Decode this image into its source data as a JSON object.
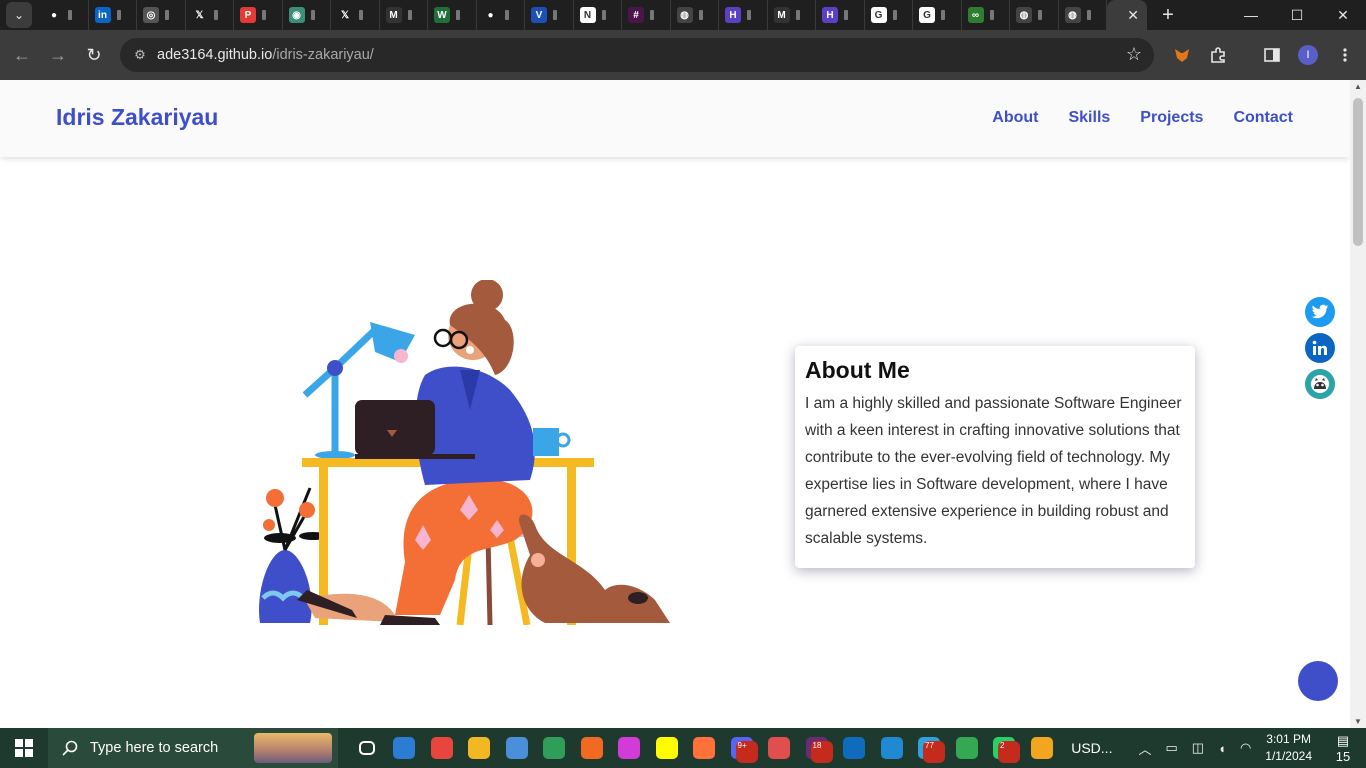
{
  "browser": {
    "menu_glyph": "⌄",
    "tabs": [
      {
        "icon": "github-icon",
        "color": "#1f1f1f",
        "glyph": "●"
      },
      {
        "icon": "linkedin-icon",
        "color": "#0a66c2",
        "glyph": "in"
      },
      {
        "icon": "globe-icon",
        "color": "#555555",
        "glyph": "◎"
      },
      {
        "icon": "x-icon",
        "color": "#1f1f1f",
        "glyph": "𝕏"
      },
      {
        "icon": "p-icon",
        "color": "#e53935",
        "glyph": "P"
      },
      {
        "icon": "openai-icon",
        "color": "#3b8f78",
        "glyph": "◉"
      },
      {
        "icon": "x-icon",
        "color": "#1f1f1f",
        "glyph": "𝕏"
      },
      {
        "icon": "m-icon",
        "color": "#333333",
        "glyph": "M"
      },
      {
        "icon": "w-icon",
        "color": "#1f6f3a",
        "glyph": "W"
      },
      {
        "icon": "github-icon",
        "color": "#1f1f1f",
        "glyph": "●"
      },
      {
        "icon": "v-icon",
        "color": "#1d4fb8",
        "glyph": "V"
      },
      {
        "icon": "notion-icon",
        "color": "#ffffff",
        "glyph": "N"
      },
      {
        "icon": "slack-icon",
        "color": "#4a154b",
        "glyph": "#"
      },
      {
        "icon": "chrome-icon",
        "color": "#444444",
        "glyph": "◍"
      },
      {
        "icon": "h-icon",
        "color": "#5b3fc4",
        "glyph": "H"
      },
      {
        "icon": "gmail-icon",
        "color": "#333333",
        "glyph": "M"
      },
      {
        "icon": "h-icon",
        "color": "#5b3fc4",
        "glyph": "H"
      },
      {
        "icon": "google-icon",
        "color": "#ffffff",
        "glyph": "G"
      },
      {
        "icon": "google-icon",
        "color": "#ffffff",
        "glyph": "G"
      },
      {
        "icon": "link-icon",
        "color": "#2e7d32",
        "glyph": "∞"
      },
      {
        "icon": "chrome-icon",
        "color": "#444444",
        "glyph": "◍"
      },
      {
        "icon": "chrome-icon",
        "color": "#444444",
        "glyph": "◍"
      }
    ],
    "active_tab_close": "✕",
    "new_tab": "+",
    "window_controls": {
      "minimize": "—",
      "maximize": "☐",
      "close": "✕"
    },
    "back": "←",
    "forward": "→",
    "reload": "↻",
    "site_info": "⚙",
    "url_host": "ade3164.github.io",
    "url_path": "/idris-zakariyau/",
    "bookmark": "☆",
    "profile_initial": "I"
  },
  "site": {
    "brand": "Idris Zakariyau",
    "nav": {
      "about": "About",
      "skills": "Skills",
      "projects": "Projects",
      "contact": "Contact"
    },
    "about": {
      "title": "About Me",
      "body": "I am a highly skilled and passionate Software Engineer with a keen interest in crafting innovative solutions that contribute to the ever-evolving field of technology. My expertise lies in Software development, where I have garnered extensive experience in building robust and scalable systems."
    },
    "socials": [
      {
        "name": "twitter-icon",
        "color": "#1d9bf0"
      },
      {
        "name": "linkedin-icon",
        "color": "#0a66c2"
      },
      {
        "name": "github-icon",
        "color": "#2ba3a8"
      }
    ],
    "fab_color": "#3f4fc9"
  },
  "taskbar": {
    "search_placeholder": "Type here to search",
    "apps": [
      {
        "name": "task-view-icon",
        "color": "#1e3a2e",
        "badge": ""
      },
      {
        "name": "mail-icon",
        "color": "#2b7cd3",
        "badge": ""
      },
      {
        "name": "chrome-icon",
        "color": "#e8453c",
        "badge": ""
      },
      {
        "name": "file-explorer-icon",
        "color": "#f2b824",
        "badge": ""
      },
      {
        "name": "store-icon",
        "color": "#4a90d9",
        "badge": ""
      },
      {
        "name": "stocks-icon",
        "color": "#2e9e58",
        "badge": ""
      },
      {
        "name": "brave-icon",
        "color": "#f26a21",
        "badge": ""
      },
      {
        "name": "app-w-icon",
        "color": "#d23bd8",
        "badge": ""
      },
      {
        "name": "snapchat-icon",
        "color": "#fffc00",
        "badge": ""
      },
      {
        "name": "firefox-icon",
        "color": "#ff7139",
        "badge": ""
      },
      {
        "name": "discord-icon",
        "color": "#5865f2",
        "badge": "9+"
      },
      {
        "name": "link-app-icon",
        "color": "#e04e4e",
        "badge": ""
      },
      {
        "name": "slack-icon",
        "color": "#6a2c70",
        "badge": "18"
      },
      {
        "name": "outlook-icon",
        "color": "#0f6cbd",
        "badge": ""
      },
      {
        "name": "vscode-icon",
        "color": "#1f8ad2",
        "badge": ""
      },
      {
        "name": "telegram-icon",
        "color": "#2aa3e0",
        "badge": "77"
      },
      {
        "name": "chrome-icon",
        "color": "#34a853",
        "badge": ""
      },
      {
        "name": "whatsapp-icon",
        "color": "#25d366",
        "badge": "2"
      },
      {
        "name": "layers-icon",
        "color": "#f2a61f",
        "badge": ""
      }
    ],
    "usd_label": "USD...",
    "time": "3:01 PM",
    "date": "1/1/2024",
    "notifications": "15"
  }
}
